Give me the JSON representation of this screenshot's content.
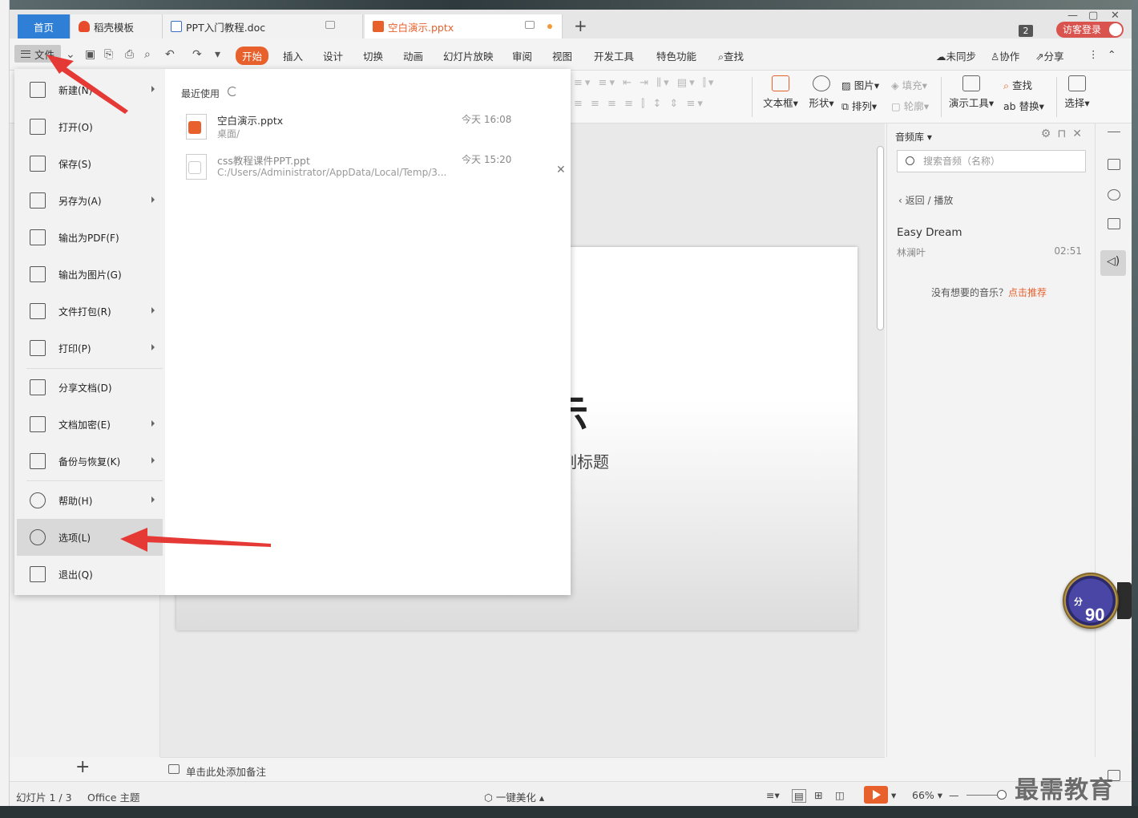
{
  "tabs": {
    "home": "首页",
    "t2": "稻壳模板",
    "t3": "PPT入门教程.doc",
    "t4": "空白演示.pptx",
    "new_tab": "+"
  },
  "titlebar": {
    "badge_count": "2",
    "login": "访客登录",
    "min": "—",
    "max": "▢",
    "close": "✕"
  },
  "menubar": {
    "file": "文件",
    "tabs": [
      "开始",
      "插入",
      "设计",
      "切换",
      "动画",
      "幻灯片放映",
      "审阅",
      "视图",
      "开发工具",
      "特色功能",
      "查找"
    ],
    "right": [
      "未同步",
      "协作",
      "分享"
    ]
  },
  "ribbon": {
    "textbox": "文本框",
    "shape": "形状",
    "picture": "图片",
    "fill": "填充",
    "arrange": "排列",
    "outline": "轮廓",
    "present_tools": "演示工具",
    "find": "查找",
    "replace": "替换",
    "select": "选择"
  },
  "file_menu": {
    "items": [
      {
        "label": "新建(N)",
        "icon": "new-file-icon",
        "submenu": true
      },
      {
        "label": "打开(O)",
        "icon": "folder-open-icon",
        "submenu": false
      },
      {
        "label": "保存(S)",
        "icon": "save-icon",
        "submenu": false
      },
      {
        "label": "另存为(A)",
        "icon": "save-as-icon",
        "submenu": true
      },
      {
        "label": "输出为PDF(F)",
        "icon": "pdf-export-icon",
        "submenu": false
      },
      {
        "label": "输出为图片(G)",
        "icon": "image-export-icon",
        "submenu": false
      },
      {
        "label": "文件打包(R)",
        "icon": "package-icon",
        "submenu": true
      },
      {
        "label": "打印(P)",
        "icon": "printer-icon",
        "submenu": true
      },
      {
        "label": "分享文档(D)",
        "icon": "share-icon",
        "submenu": false
      },
      {
        "label": "文档加密(E)",
        "icon": "lock-file-icon",
        "submenu": true
      },
      {
        "label": "备份与恢复(K)",
        "icon": "backup-icon",
        "submenu": true
      },
      {
        "label": "帮助(H)",
        "icon": "help-icon",
        "submenu": true
      },
      {
        "label": "选项(L)",
        "icon": "gear-icon",
        "submenu": false
      },
      {
        "label": "退出(Q)",
        "icon": "exit-icon",
        "submenu": false
      }
    ],
    "recent_title": "最近使用",
    "recent": [
      {
        "name": "空白演示.pptx",
        "path": "桌面/",
        "time": "今天 16:08"
      },
      {
        "name": "css教程课件PPT.ppt",
        "path": "C:/Users/Administrator/AppData/Local/Temp/3...",
        "time": "今天 15:20"
      }
    ]
  },
  "slide": {
    "title_fragment": "示",
    "subtitle_fragment": "副标题"
  },
  "notes": {
    "placeholder": "单击此处添加备注"
  },
  "audio_panel": {
    "title": "音频库",
    "search_placeholder": "搜索音频（名称）",
    "back": "返回",
    "crumb_sep": "/",
    "crumb_current": "播放",
    "song": "Easy Dream",
    "artist": "林澜叶",
    "duration": "02:51",
    "no_music_text": "没有想要的音乐？",
    "recommend_link": "点击推荐"
  },
  "status": {
    "slide_count": "幻灯片 1 / 3",
    "theme": "Office 主题",
    "beautify": "一键美化",
    "zoom": "66%"
  },
  "overlay": {
    "score": "90",
    "score_unit": "分",
    "watermark": "最需教育"
  },
  "colors": {
    "accent": "#e8612c",
    "home_tab": "#2f7fd6",
    "login": "#d9534f",
    "arrow": "#e53935"
  }
}
